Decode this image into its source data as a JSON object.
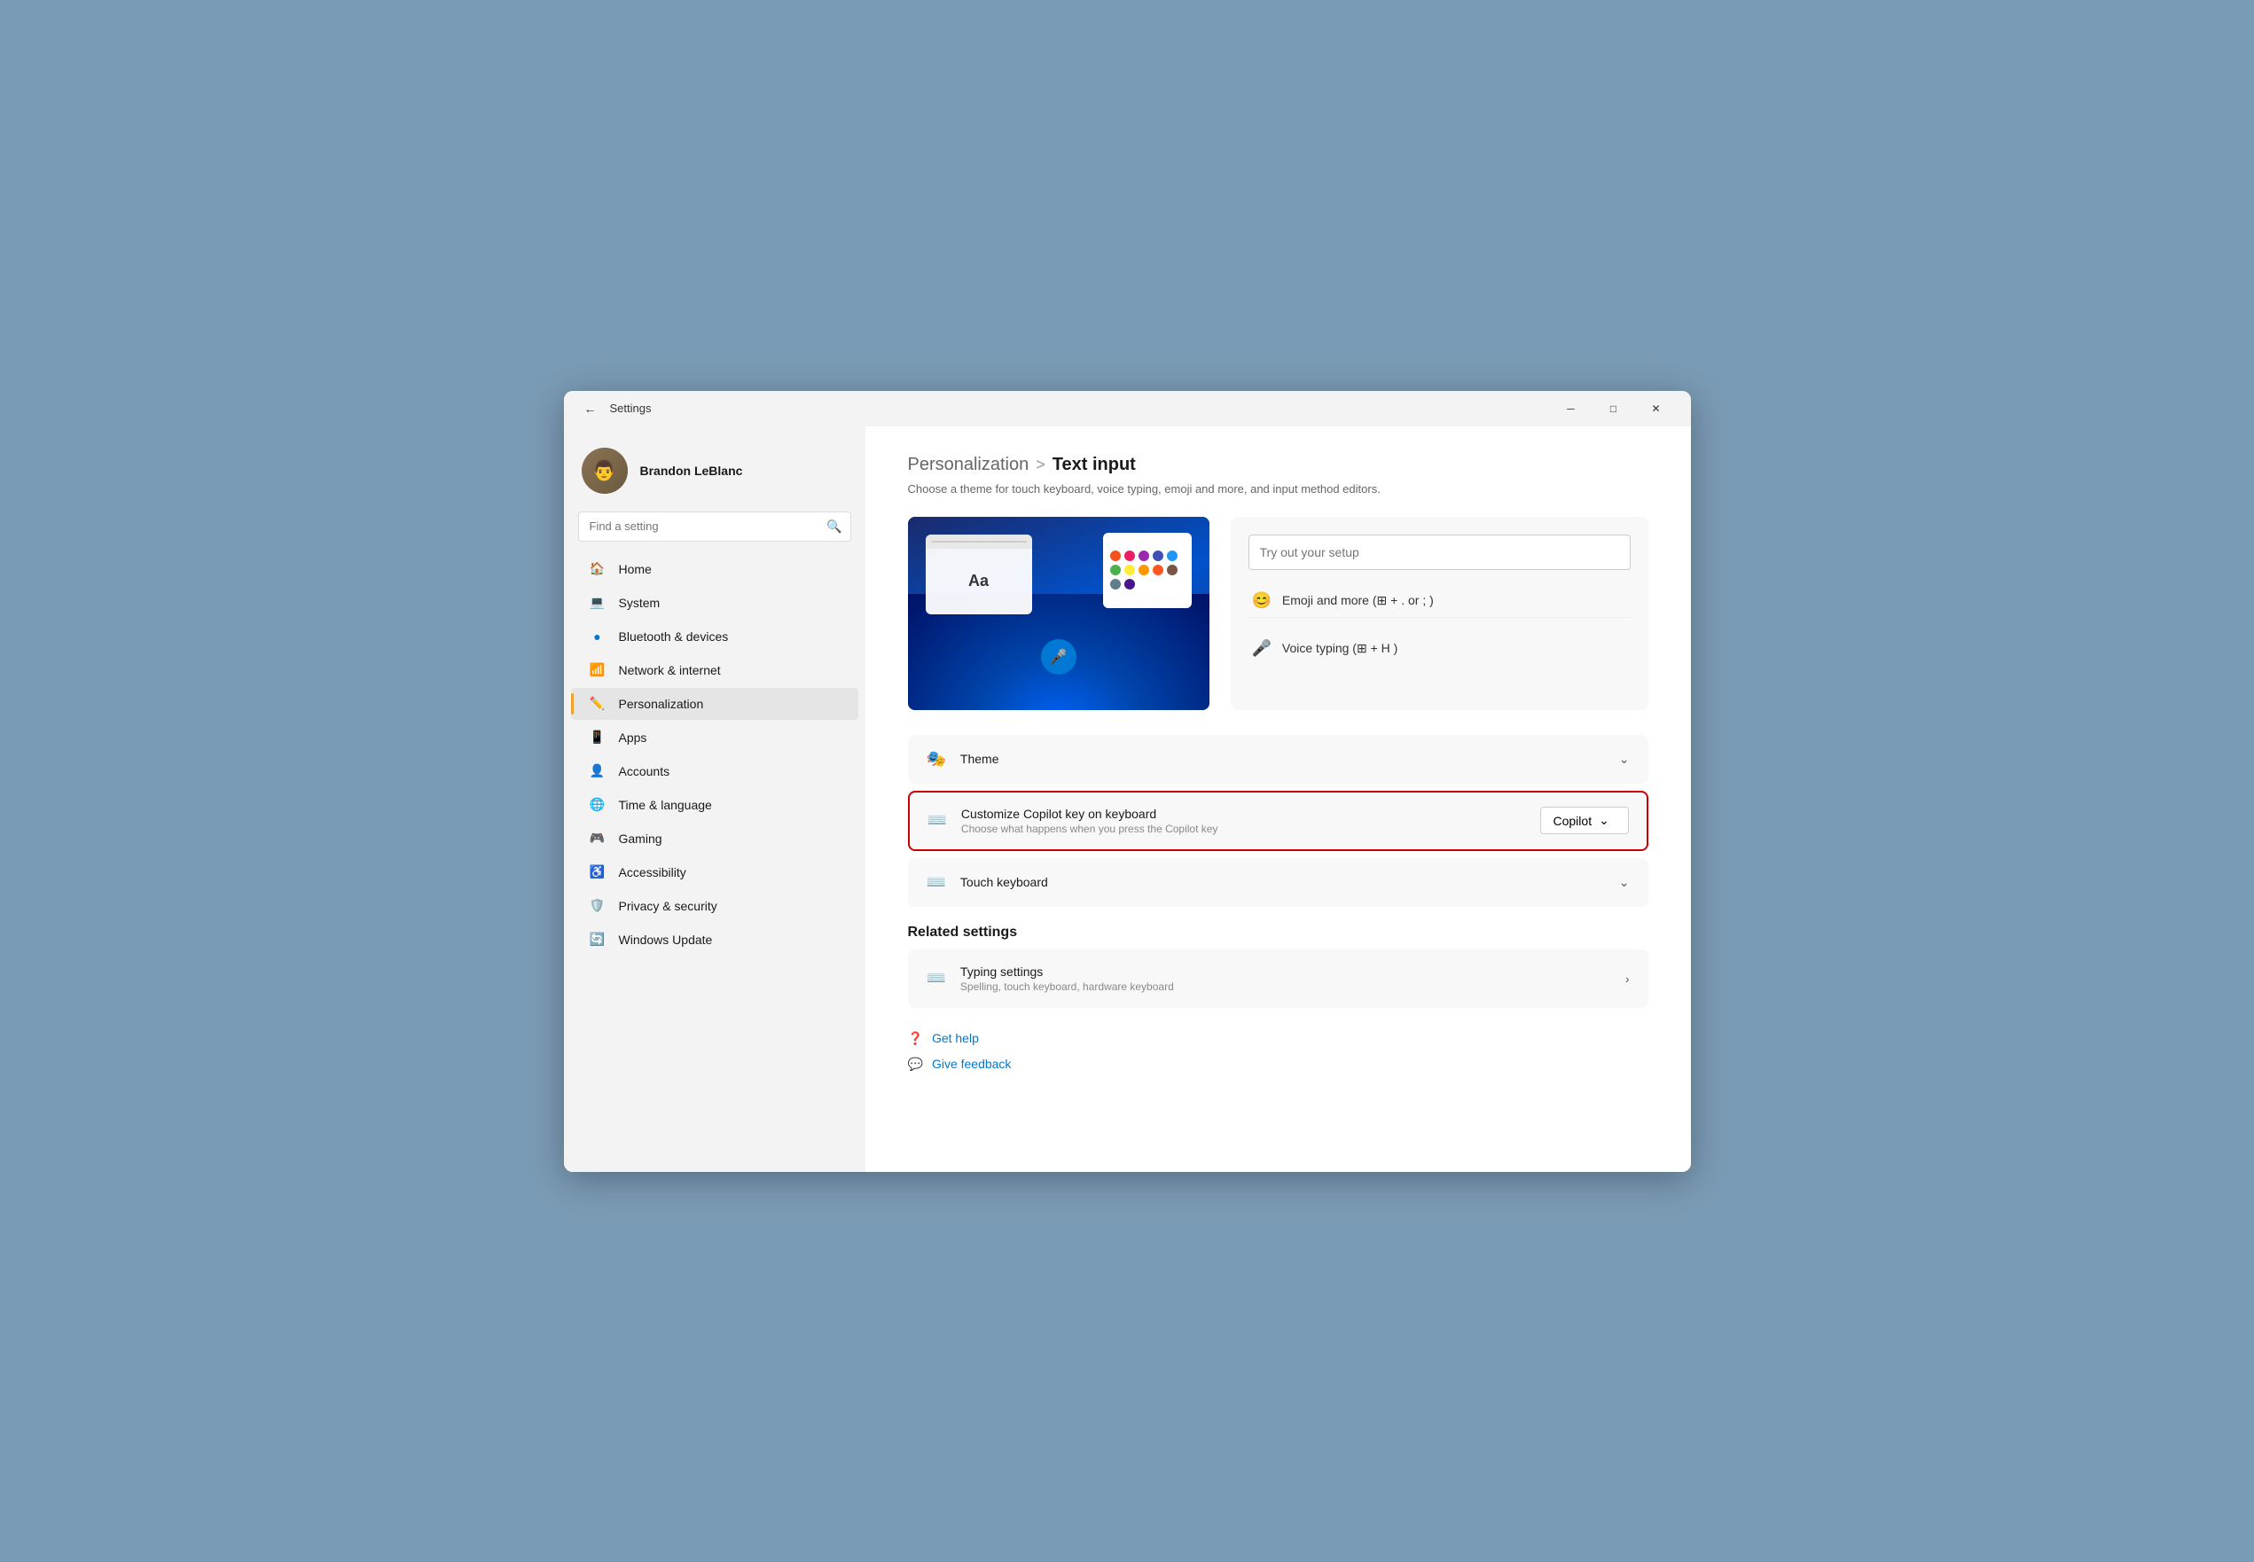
{
  "window": {
    "title": "Settings",
    "controls": {
      "minimize": "─",
      "maximize": "□",
      "close": "✕"
    }
  },
  "sidebar": {
    "user": {
      "name": "Brandon LeBlanc"
    },
    "search": {
      "placeholder": "Find a setting"
    },
    "nav_items": [
      {
        "id": "home",
        "label": "Home",
        "icon": "🏠"
      },
      {
        "id": "system",
        "label": "System",
        "icon": "💻"
      },
      {
        "id": "bluetooth",
        "label": "Bluetooth & devices",
        "icon": "🔵"
      },
      {
        "id": "network",
        "label": "Network & internet",
        "icon": "📶"
      },
      {
        "id": "personalization",
        "label": "Personalization",
        "icon": "✏️",
        "active": true
      },
      {
        "id": "apps",
        "label": "Apps",
        "icon": "📱"
      },
      {
        "id": "accounts",
        "label": "Accounts",
        "icon": "👤"
      },
      {
        "id": "time",
        "label": "Time & language",
        "icon": "🌐"
      },
      {
        "id": "gaming",
        "label": "Gaming",
        "icon": "🎮"
      },
      {
        "id": "accessibility",
        "label": "Accessibility",
        "icon": "♿"
      },
      {
        "id": "privacy",
        "label": "Privacy & security",
        "icon": "🛡️"
      },
      {
        "id": "windows-update",
        "label": "Windows Update",
        "icon": "🔄"
      }
    ]
  },
  "main": {
    "breadcrumb_parent": "Personalization",
    "breadcrumb_sep": ">",
    "breadcrumb_current": "Text input",
    "subtitle": "Choose a theme for touch keyboard, voice typing, emoji and more, and input method editors.",
    "tryout": {
      "placeholder": "Try out your setup",
      "emoji_label": "Emoji and more (⊞ + .  or ; )",
      "voice_label": "Voice typing (⊞ + H )"
    },
    "settings": {
      "theme_label": "Theme",
      "copilot_row": {
        "title": "Customize Copilot key on keyboard",
        "subtitle": "Choose what happens when you press the Copilot key",
        "value": "Copilot",
        "highlighted": true
      },
      "touch_keyboard_label": "Touch keyboard"
    },
    "related": {
      "title": "Related settings",
      "typing": {
        "title": "Typing settings",
        "subtitle": "Spelling, touch keyboard, hardware keyboard"
      }
    },
    "links": {
      "get_help": "Get help",
      "give_feedback": "Give feedback"
    }
  },
  "colors": {
    "accent": "#0078d4",
    "personalization_icon": "#f0a030",
    "highlight_border": "#cc0000",
    "color_dots": [
      "#f4511e",
      "#e91e63",
      "#9c27b0",
      "#3f51b5",
      "#2196f3",
      "#4caf50",
      "#ffeb3b",
      "#ff5722",
      "#795548",
      "#607d8b",
      "#9e9e9e",
      "#4a148c"
    ]
  }
}
